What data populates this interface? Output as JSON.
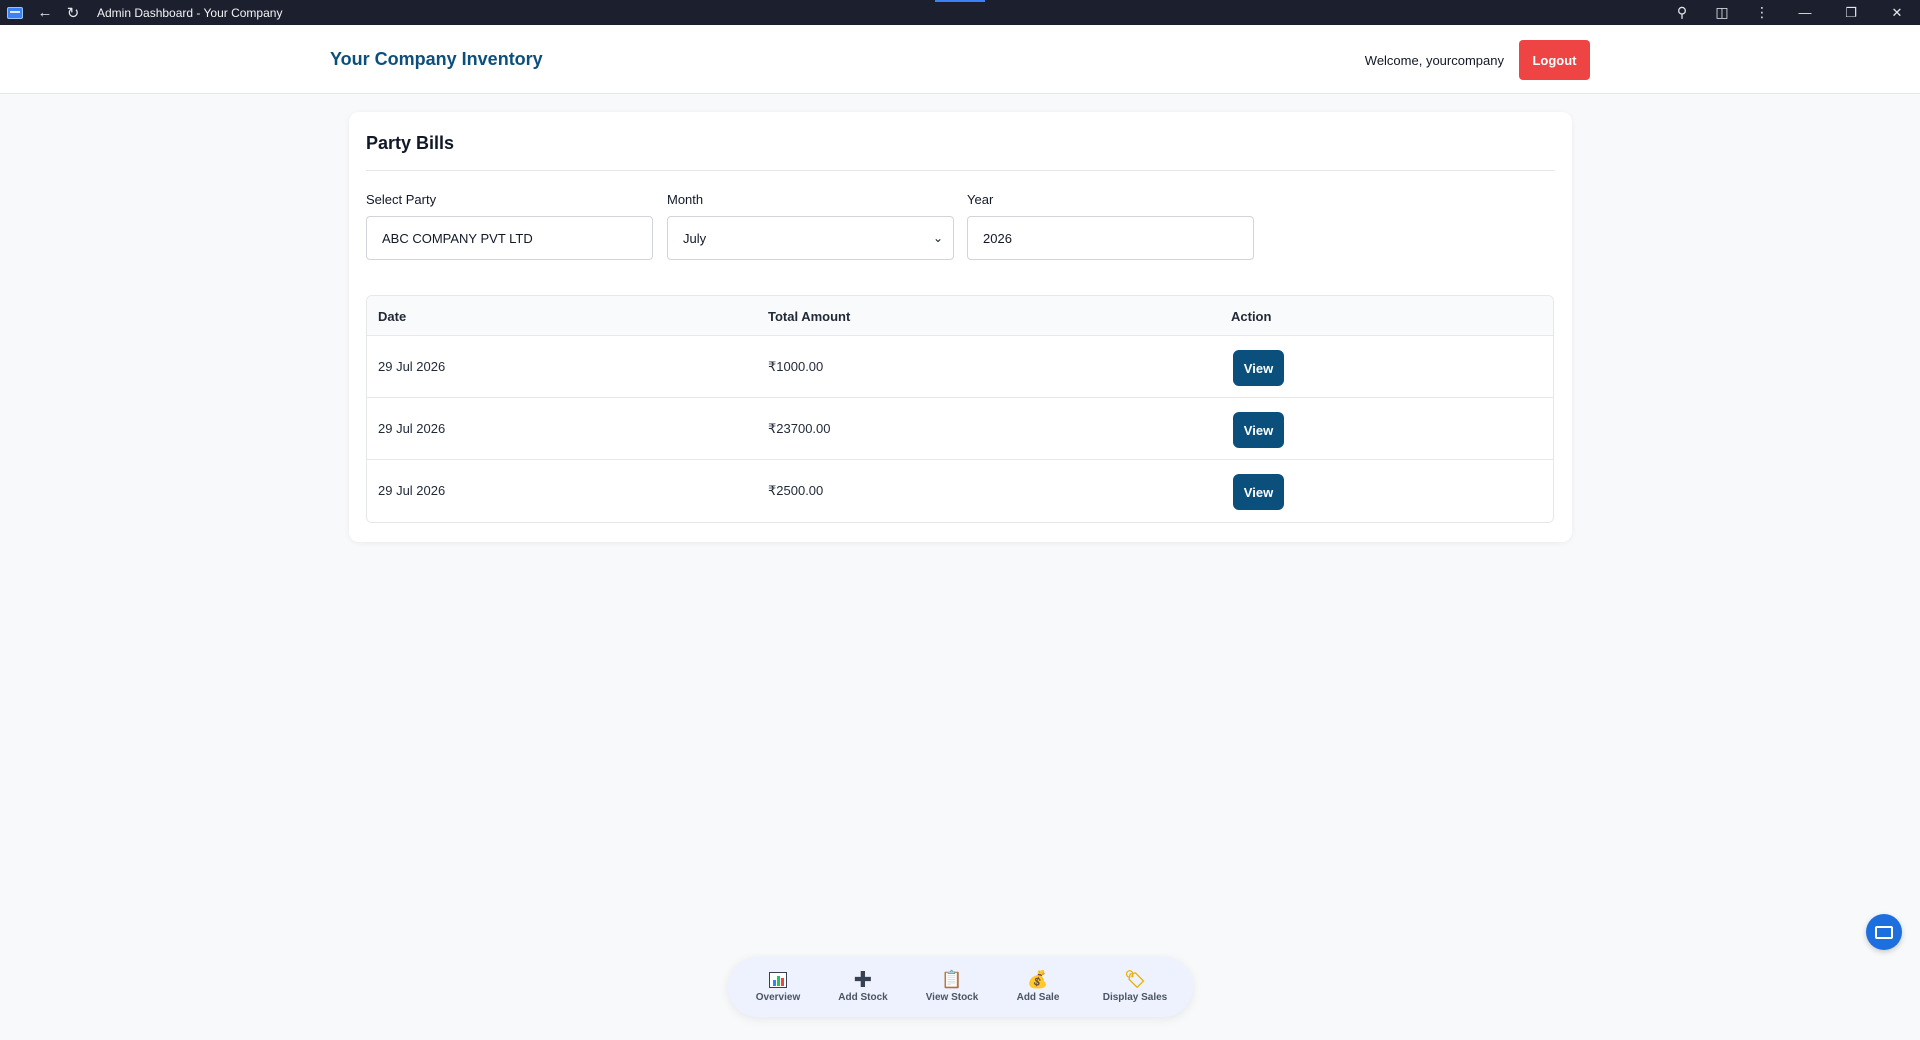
{
  "browser": {
    "title": "Admin Dashboard - Your Company"
  },
  "header": {
    "brand": "Your Company Inventory",
    "welcome": "Welcome, yourcompany",
    "logout_label": "Logout"
  },
  "card": {
    "title": "Party Bills",
    "filters": {
      "party_label": "Select Party",
      "party_value": "ABC COMPANY PVT LTD",
      "month_label": "Month",
      "month_value": "July",
      "year_label": "Year",
      "year_value": "2026"
    },
    "table": {
      "columns": [
        "Date",
        "Total Amount",
        "Action"
      ],
      "rows": [
        {
          "date": "29 Jul 2026",
          "amount": "₹1000.00",
          "action": "View"
        },
        {
          "date": "29 Jul 2026",
          "amount": "₹23700.00",
          "action": "View"
        },
        {
          "date": "29 Jul 2026",
          "amount": "₹2500.00",
          "action": "View"
        }
      ]
    }
  },
  "bottom_nav": {
    "items": [
      {
        "label": "Overview",
        "icon": "bar-chart-icon"
      },
      {
        "label": "Add Stock",
        "icon": "plus-icon"
      },
      {
        "label": "View Stock",
        "icon": "clipboard-icon"
      },
      {
        "label": "Add Sale",
        "icon": "money-bag-icon"
      },
      {
        "label": "Display Sales",
        "icon": "tag-icon"
      }
    ]
  },
  "colors": {
    "brand": "#0b4f7c",
    "logout": "#ef4444",
    "view_button": "#0b4f7c",
    "fab": "#1d6fe0"
  }
}
